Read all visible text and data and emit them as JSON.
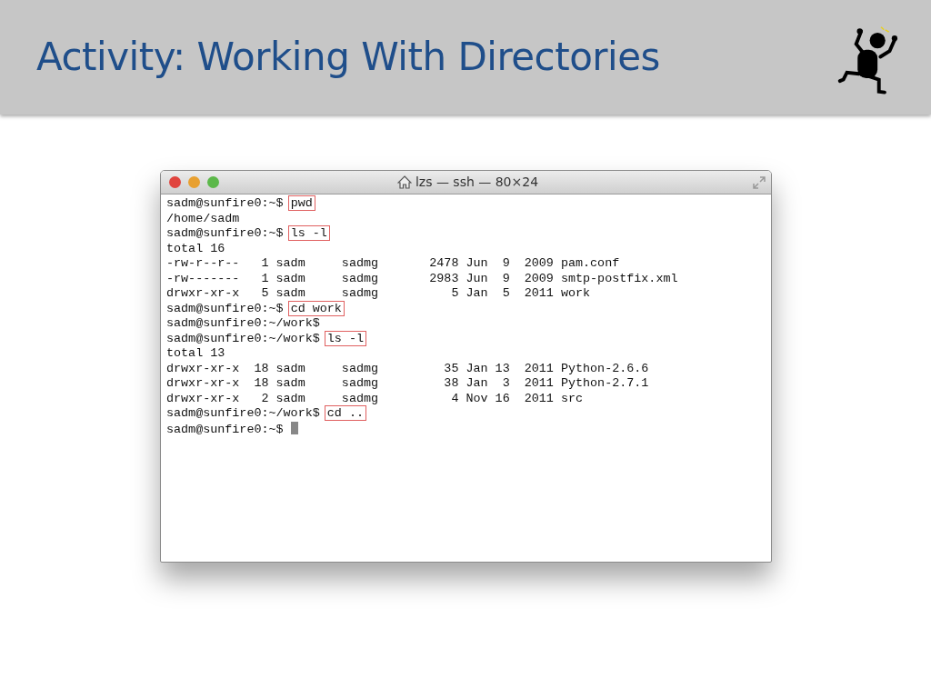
{
  "slide": {
    "title": "Activity: Working With Directories"
  },
  "window": {
    "title": "lzs — ssh — 80×24"
  },
  "terminal": {
    "lines": [
      {
        "kind": "prompt",
        "prompt": "sadm@sunfire0:~$",
        "command": "pwd"
      },
      {
        "kind": "output",
        "text": "/home/sadm"
      },
      {
        "kind": "prompt",
        "prompt": "sadm@sunfire0:~$",
        "command": "ls -l"
      },
      {
        "kind": "output",
        "text": "total 16"
      },
      {
        "kind": "output",
        "text": "-rw-r--r--   1 sadm     sadmg       2478 Jun  9  2009 pam.conf"
      },
      {
        "kind": "output",
        "text": "-rw-------   1 sadm     sadmg       2983 Jun  9  2009 smtp-postfix.xml"
      },
      {
        "kind": "output",
        "text": "drwxr-xr-x   5 sadm     sadmg          5 Jan  5  2011 work"
      },
      {
        "kind": "prompt",
        "prompt": "sadm@sunfire0:~$",
        "command": "cd work"
      },
      {
        "kind": "prompt",
        "prompt": "sadm@sunfire0:~/work$"
      },
      {
        "kind": "prompt",
        "prompt": "sadm@sunfire0:~/work$",
        "command": "ls -l"
      },
      {
        "kind": "output",
        "text": "total 13"
      },
      {
        "kind": "output",
        "text": "drwxr-xr-x  18 sadm     sadmg         35 Jan 13  2011 Python-2.6.6"
      },
      {
        "kind": "output",
        "text": "drwxr-xr-x  18 sadm     sadmg         38 Jan  3  2011 Python-2.7.1"
      },
      {
        "kind": "output",
        "text": "drwxr-xr-x   2 sadm     sadmg          4 Nov 16  2011 src"
      },
      {
        "kind": "prompt",
        "prompt": "sadm@sunfire0:~/work$",
        "command": "cd .."
      },
      {
        "kind": "prompt",
        "prompt": "sadm@sunfire0:~$",
        "cursor": true
      }
    ]
  }
}
